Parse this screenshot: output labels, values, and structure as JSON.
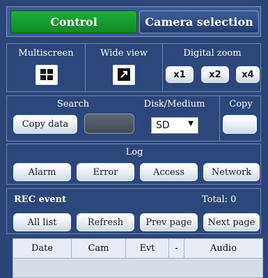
{
  "tabs": [
    {
      "label": "Control",
      "active": true
    },
    {
      "label": "Camera selection",
      "active": false
    }
  ],
  "multiscreen": {
    "label": "Multiscreen",
    "icon": "grid-four-icon"
  },
  "wide_view": {
    "label": "Wide view",
    "icon": "expand-arrow-icon"
  },
  "digital_zoom": {
    "label": "Digital zoom",
    "buttons": [
      "x1",
      "x2",
      "x4"
    ]
  },
  "search": {
    "label": "Search",
    "copy_data": "Copy data"
  },
  "disk_medium": {
    "label": "Disk/Medium",
    "selected": "SD"
  },
  "copy": {
    "label": "Copy"
  },
  "log": {
    "label": "Log",
    "buttons": [
      "Alarm",
      "Error",
      "Access",
      "Network"
    ]
  },
  "rec_event": {
    "label": "REC event",
    "total": "Total: 0",
    "buttons": [
      "All list",
      "Refresh",
      "Prev page",
      "Next page"
    ]
  },
  "table": {
    "columns": [
      "Date",
      "Cam",
      "Evt",
      "-",
      "Audio"
    ],
    "rows": []
  },
  "colors": {
    "active_tab": "#17a03a",
    "panel": "#2b4579"
  }
}
